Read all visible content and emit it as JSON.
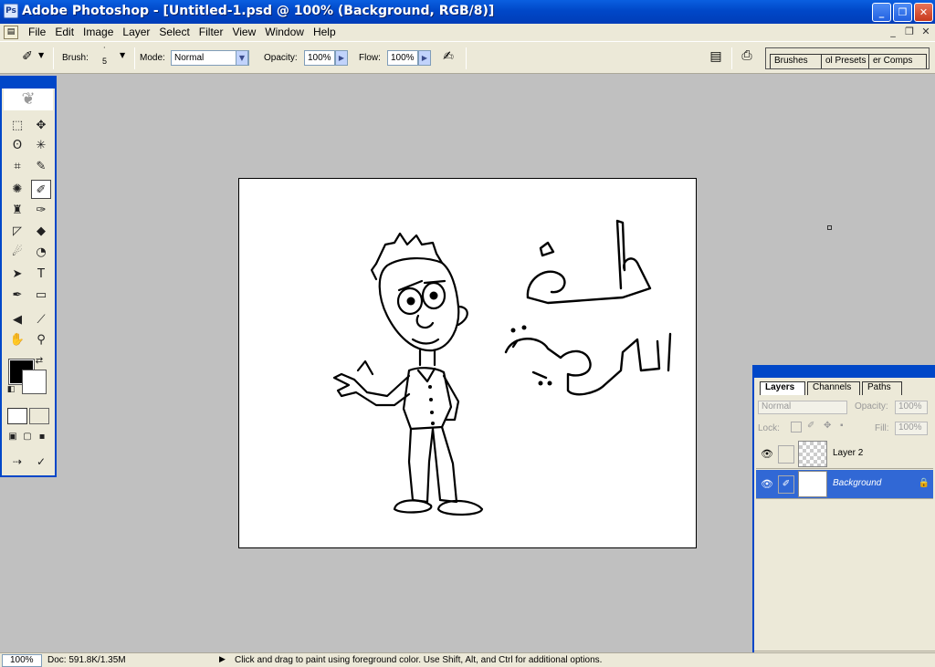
{
  "window": {
    "title": "Adobe Photoshop - [Untitled-1.psd @ 100% (Background, RGB/8)]",
    "controls": {
      "minimize": "_",
      "maximize": "❐",
      "close": "✕"
    }
  },
  "menu": {
    "items": [
      "File",
      "Edit",
      "Image",
      "Layer",
      "Select",
      "Filter",
      "View",
      "Window",
      "Help"
    ],
    "mdi": {
      "minimize": "_",
      "restore": "❐",
      "close": "✕"
    }
  },
  "options": {
    "brush_label": "Brush:",
    "brush_size": "5",
    "mode_label": "Mode:",
    "mode_value": "Normal",
    "opacity_label": "Opacity:",
    "opacity_value": "100%",
    "flow_label": "Flow:",
    "flow_value": "100%",
    "palette_well_tabs": [
      "Brushes",
      "ol Presets",
      "er Comps"
    ]
  },
  "toolbox": {
    "tools": [
      {
        "name": "marquee-tool-icon",
        "glyph": "⬚"
      },
      {
        "name": "move-tool-icon",
        "glyph": "✥"
      },
      {
        "name": "lasso-tool-icon",
        "glyph": "ʘ"
      },
      {
        "name": "magic-wand-tool-icon",
        "glyph": "✳"
      },
      {
        "name": "crop-tool-icon",
        "glyph": "⌗"
      },
      {
        "name": "slice-tool-icon",
        "glyph": "✎"
      },
      {
        "name": "healing-brush-tool-icon",
        "glyph": "✺"
      },
      {
        "name": "brush-tool-icon",
        "glyph": "✐"
      },
      {
        "name": "clone-stamp-tool-icon",
        "glyph": "♜"
      },
      {
        "name": "history-brush-tool-icon",
        "glyph": "✑"
      },
      {
        "name": "eraser-tool-icon",
        "glyph": "◸"
      },
      {
        "name": "paint-bucket-tool-icon",
        "glyph": "◆"
      },
      {
        "name": "blur-tool-icon",
        "glyph": "☄"
      },
      {
        "name": "dodge-tool-icon",
        "glyph": "◔"
      },
      {
        "name": "path-selection-tool-icon",
        "glyph": "➤"
      },
      {
        "name": "type-tool-icon",
        "glyph": "T"
      },
      {
        "name": "pen-tool-icon",
        "glyph": "✒"
      },
      {
        "name": "rectangle-tool-icon",
        "glyph": "▭"
      },
      {
        "name": "notes-tool-icon",
        "glyph": "◀"
      },
      {
        "name": "eyedropper-tool-icon",
        "glyph": "⟋"
      },
      {
        "name": "hand-tool-icon",
        "glyph": "✋"
      },
      {
        "name": "zoom-tool-icon",
        "glyph": "⚲"
      }
    ],
    "foreground_color": "#000000",
    "background_color": "#ffffff"
  },
  "layers_palette": {
    "tabs": [
      "Layers",
      "Channels",
      "Paths"
    ],
    "blend_mode": "Normal",
    "opacity_label": "Opacity:",
    "opacity_value": "100%",
    "lock_label": "Lock:",
    "fill_label": "Fill:",
    "fill_value": "100%",
    "layers": [
      {
        "name": "Layer 2",
        "selected": false,
        "locked": false
      },
      {
        "name": "Background",
        "selected": true,
        "locked": true
      }
    ]
  },
  "status": {
    "zoom": "100%",
    "doc_info": "Doc: 591.8K/1.35M",
    "hint": "Click and drag to paint using foreground color.  Use Shift, Alt, and Ctrl for additional options."
  },
  "colors": {
    "title_bar": "#0047c8",
    "chrome": "#ece9d8",
    "workspace": "#c0c0c0",
    "selection": "#3168d5"
  }
}
